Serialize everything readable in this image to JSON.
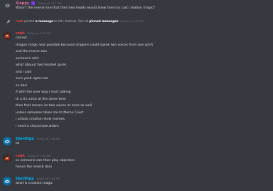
{
  "colors": {
    "background": "#36393f",
    "text": "#dcddde",
    "muted": "#72767d",
    "sloppy": "#e06c9f",
    "roah": "#ed4245",
    "danidipp": "#00b0f4"
  },
  "messages": {
    "m1": {
      "author": "Sloppy",
      "timestamp": "Today at 7:47 AM",
      "lines": [
        "Wasn't the meme lore that their two heads would allow them to cast creation magic?"
      ]
    },
    "pin": {
      "actor": "roah",
      "text_a": "pinned",
      "text_b": "a message",
      "text_c": "to this channel. See all",
      "text_d": "pinned messages",
      "timestamp": "Today at 7:47 AM"
    },
    "m2": {
      "author": "roah",
      "timestamp": "Today at 7:47 AM",
      "lines": [
        "correct",
        "dragon magic was possible because dragons could speak two voices from one spirit",
        "and the meme was",
        "someone said",
        "what abouut two headed gores",
        "and i said",
        "sure yeah ogres too",
        "so dani",
        "if with the over way i start talking",
        "to a tts voice at the same time",
        "then that means im two voices at once as well",
        "unless someone takes me to Meme Court",
        "i unlock creation level memes.",
        "i need a checkmate.webm"
      ]
    },
    "m3": {
      "author": "DaniDipp",
      "timestamp": "Today at 7:48 AM",
      "lines": [
        "lol"
      ]
    },
    "m4": {
      "author": "roah",
      "timestamp": "Today at 7:49 AM",
      "lines": [
        "so someone can then play objection",
        "hence the reverb dani"
      ]
    },
    "m5": {
      "author": "DaniDipp",
      "timestamp": "Today at 7:49 AM",
      "lines": [
        "what is creation magic"
      ]
    }
  }
}
